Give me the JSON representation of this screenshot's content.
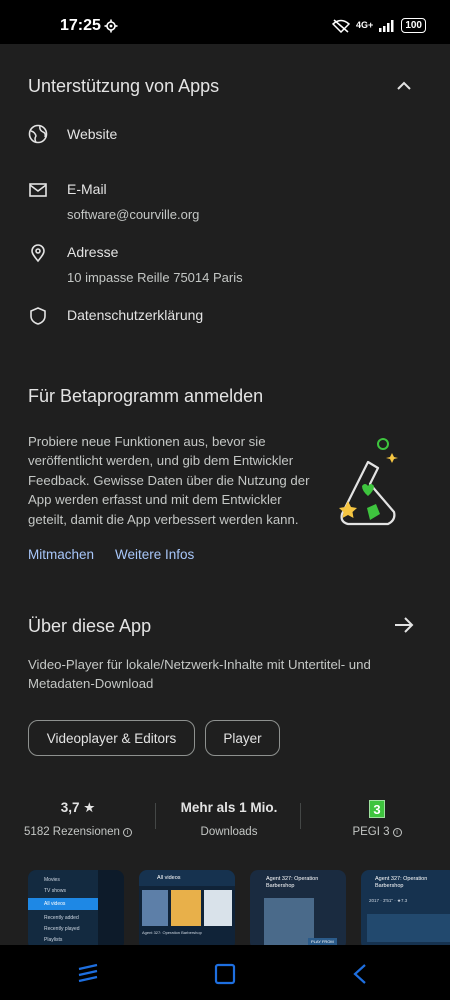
{
  "status_bar": {
    "time": "17:25",
    "network": "4G+",
    "battery": "100"
  },
  "support": {
    "title": "Unterstützung von Apps",
    "website_label": "Website",
    "email_label": "E-Mail",
    "email_value": "software@courville.org",
    "address_label": "Adresse",
    "address_value": "10 impasse Reille 75014 Paris",
    "privacy_label": "Datenschutzerklärung"
  },
  "beta": {
    "title": "Für Betaprogramm anmelden",
    "lines": [
      "Probiere neue Funktionen aus, bevor sie",
      "veröffentlicht werden, und gib dem Entwickler",
      "Feedback. Gewisse Daten über die Nutzung der",
      "App werden erfasst und mit dem Entwickler",
      "geteilt, damit die App verbessert werden kann."
    ],
    "join_link": "Mitmachen",
    "more_link": "Weitere Infos"
  },
  "about": {
    "title": "Über diese App",
    "desc_line1": "Video-Player für lokale/Netzwerk-Inhalte mit Untertitel- und",
    "desc_line2": "Metadaten-Download",
    "chips": [
      "Videoplayer & Editors",
      "Player"
    ]
  },
  "stats": {
    "rating": "3,7 ★",
    "reviews": "5182 Rezensionen",
    "downloads_big": "Mehr als 1 Mio.",
    "downloads_small": "Downloads",
    "pegi_badge": "3",
    "pegi_label": "PEGI 3"
  },
  "screenshots": {
    "s1": [
      "Movies",
      "TV shows",
      "All videos",
      "Recently added",
      "Recently played",
      "Playlists"
    ],
    "s2_title": "All videos",
    "s2_caption": "Agent 327: Operation Barbershop",
    "s3_title": "Agent 327: Operation Barbershop",
    "s3_button": "PLAY FROM",
    "s4_title": "Agent 327: Operation Barbershop",
    "s4_meta": "2017 · 3'51\" · ★7.3"
  },
  "colors": {
    "background": "#1f1f1f",
    "link": "#a8c7fa",
    "pegi_green": "#3ec43e"
  }
}
